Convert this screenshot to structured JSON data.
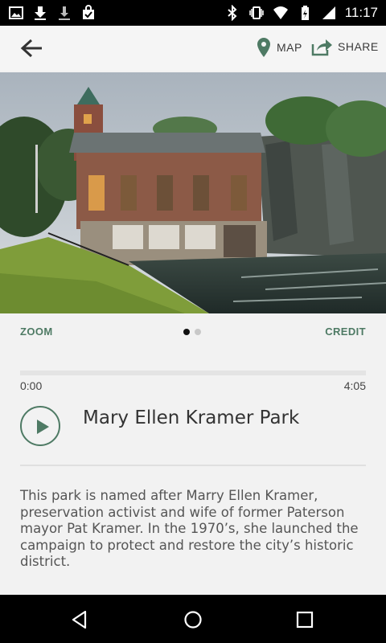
{
  "status_bar": {
    "time": "11:17",
    "icons": [
      "image-notification-icon",
      "download-icon",
      "download-icon",
      "store-icon",
      "bluetooth-icon",
      "vibrate-icon",
      "wifi-icon",
      "battery-icon",
      "signal-icon"
    ]
  },
  "app_bar": {
    "map_label": "MAP",
    "share_label": "SHARE"
  },
  "hero": {
    "gallery_index": 1,
    "gallery_count": 2
  },
  "image_controls": {
    "zoom_label": "ZOOM",
    "credit_label": "CREDIT"
  },
  "audio": {
    "elapsed": "0:00",
    "duration": "4:05",
    "progress": 0
  },
  "place": {
    "title": "Mary Ellen Kramer Park",
    "description": "This park is named after Marry Ellen Kramer, preservation activist and wife of former Paterson mayor Pat Kramer. In the 1970’s, she launched the campaign to protect and restore the city’s historic district."
  },
  "colors": {
    "accent": "#4e7a64",
    "background": "#f2f2f2"
  }
}
